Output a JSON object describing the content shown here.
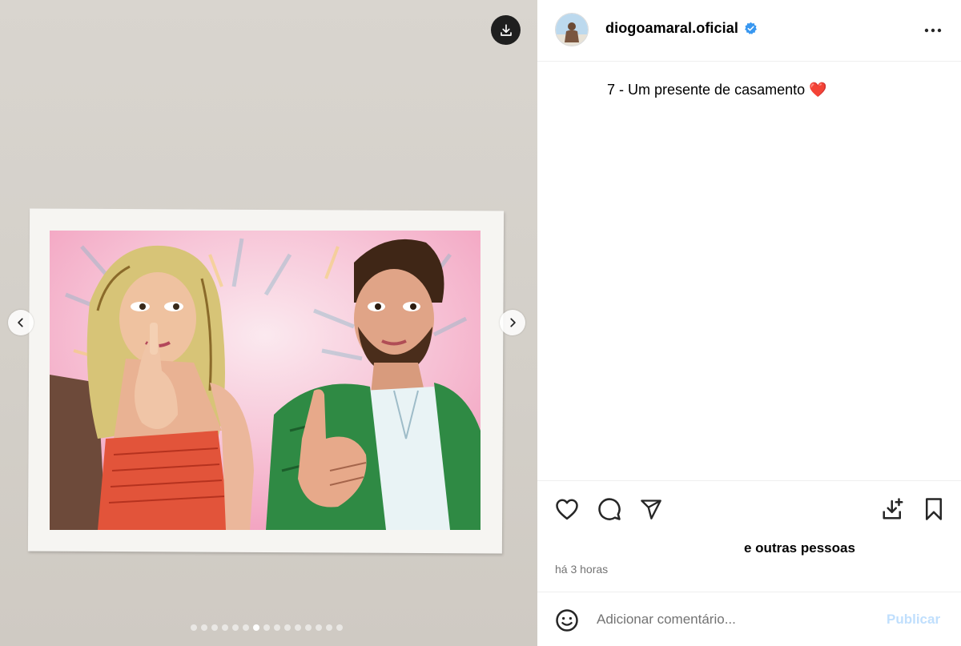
{
  "media": {
    "download_icon": "download-icon",
    "prev_icon": "chevron-left-icon",
    "next_icon": "chevron-right-icon",
    "carousel_total": 15,
    "carousel_active_index": 6
  },
  "post": {
    "username": "diogoamaral.oficial",
    "verified_icon": "verified-badge-icon",
    "more_icon": "more-horizontal-icon",
    "caption": "7 - Um presente de casamento ❤️",
    "likes_text": "e outras pessoas",
    "timestamp": "há 3 horas"
  },
  "actions": {
    "like_icon": "heart-icon",
    "comment_icon": "comment-icon",
    "share_icon": "share-icon",
    "save_media_icon": "save-media-icon",
    "bookmark_icon": "bookmark-icon"
  },
  "comment": {
    "placeholder": "Adicionar comentário...",
    "publish_label": "Publicar",
    "emoji_icon": "emoji-icon"
  },
  "colors": {
    "publish_disabled": "#c0dffd",
    "verified": "#3897f0",
    "secondary_text": "#737373"
  }
}
